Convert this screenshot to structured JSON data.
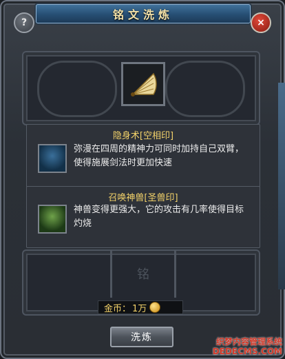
{
  "window": {
    "title": "铭文洗炼"
  },
  "controls": {
    "help_label": "?",
    "close_label": "×"
  },
  "skills": [
    {
      "name": "隐身术[空相印]",
      "description": "弥漫在四周的精神力可同时加持自己双臂，使得施展剑法时更加快速",
      "icon": "stealth-skill-icon"
    },
    {
      "name": "召唤神兽[圣兽印]",
      "description": "神兽变得更强大，它的攻击有几率使得目标灼烧",
      "icon": "summon-beast-skill-icon"
    }
  ],
  "rune_slot": {
    "char": "铭"
  },
  "gold": {
    "label": "金币：",
    "value": "1万"
  },
  "refine_button": {
    "label": "洗炼"
  },
  "watermark": {
    "line1": "织梦内容管理系统",
    "line2": "DEDECMS.COM"
  },
  "colors": {
    "title": "#f4e2a8",
    "skill_name": "#f4d36a",
    "close": "#c0281a"
  }
}
